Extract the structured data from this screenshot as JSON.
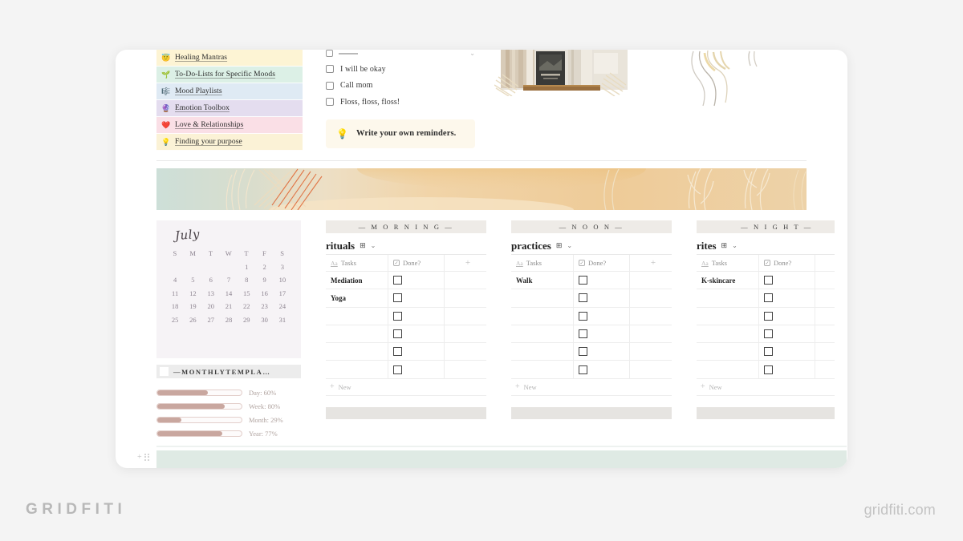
{
  "nav": {
    "items": [
      {
        "emoji": "😇",
        "label": "Healing Mantras",
        "bg": "#fdf4d4"
      },
      {
        "emoji": "🌱",
        "label": "To-Do-Lists for Specific Moods",
        "bg": "#dcf0e6"
      },
      {
        "emoji": "🎼",
        "label": "Mood Playlists",
        "bg": "#dfeaf4"
      },
      {
        "emoji": "🔮",
        "label": "Emotion Toolbox",
        "bg": "#e4ddef"
      },
      {
        "emoji": "❤️",
        "label": "Love & Relationships",
        "bg": "#fadfe6"
      },
      {
        "emoji": "💡",
        "label": "Finding your purpose",
        "bg": "#fbf2d6"
      }
    ]
  },
  "checklist": {
    "items": [
      {
        "text": "I will be okay"
      },
      {
        "text": "Call mom"
      },
      {
        "text": "Floss, floss, floss!"
      }
    ],
    "callout": {
      "emoji": "💡",
      "text": "Write your own reminders."
    }
  },
  "calendar": {
    "month": "July",
    "dow": [
      "S",
      "M",
      "T",
      "W",
      "T",
      "F",
      "S"
    ],
    "lead_blanks": 4,
    "days": [
      1,
      2,
      3,
      4,
      5,
      6,
      7,
      8,
      9,
      10,
      11,
      12,
      13,
      14,
      15,
      16,
      17,
      18,
      19,
      20,
      21,
      22,
      23,
      24,
      25,
      26,
      27,
      28,
      29,
      30,
      31
    ],
    "template_title": "—MONTHLYTEMPLA…",
    "progress": [
      {
        "label": "Day: 60%",
        "value": 60
      },
      {
        "label": "Week: 80%",
        "value": 80
      },
      {
        "label": "Month: 29%",
        "value": 29
      },
      {
        "label": "Year: 77%",
        "value": 77
      }
    ],
    "progress_colors": {
      "fill": "#c9a79f",
      "track_border": "#e3cfcb",
      "label": "#b0a39f"
    }
  },
  "tables": [
    {
      "section": "— M O R N I N G —",
      "title": "rituals",
      "columns": {
        "tasks": "Tasks",
        "done": "Done?",
        "add": "+",
        "aa": "Aa"
      },
      "rows": [
        "Mediation",
        "Yoga",
        "",
        "",
        "",
        ""
      ],
      "new_label": "New",
      "clipped": false
    },
    {
      "section": "— N O O N —",
      "title": "practices",
      "columns": {
        "tasks": "Tasks",
        "done": "Done?",
        "add": "+",
        "aa": "Aa"
      },
      "rows": [
        "Walk",
        "",
        "",
        "",
        "",
        ""
      ],
      "new_label": "New",
      "clipped": false
    },
    {
      "section": "— N I G H T —",
      "title": "rites",
      "columns": {
        "tasks": "Tasks",
        "done": "Done?",
        "add": "+",
        "aa": "Aa"
      },
      "rows": [
        "K-skincare",
        "",
        "",
        "",
        "",
        ""
      ],
      "new_label": "New",
      "clipped": true
    }
  ],
  "branding": {
    "left": "GRIDFITI",
    "right": "gridfiti.com"
  },
  "colors": {
    "page_bg": "#f4f4f4",
    "card_bg": "#ffffff",
    "section_header_bg": "#eeebe7",
    "calendar_bg": "#f6f3f6",
    "mint_bar": "#dfeae4",
    "table_footer": "#e6e4e1"
  }
}
